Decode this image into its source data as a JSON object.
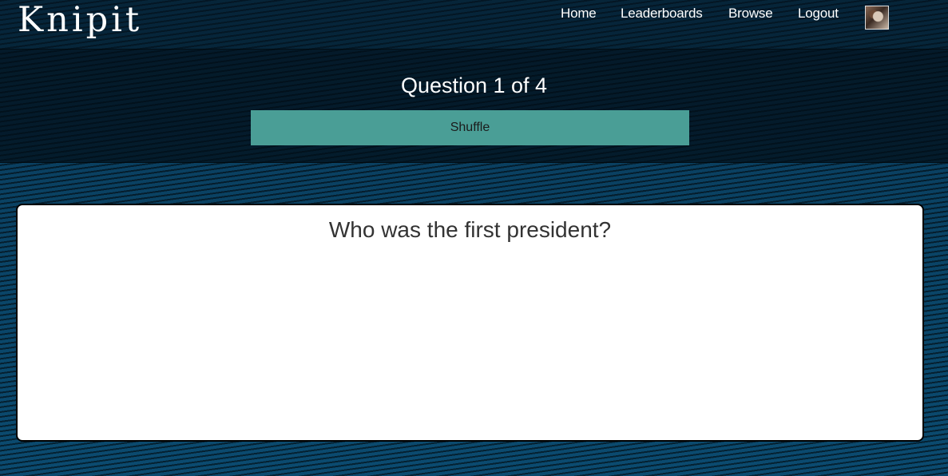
{
  "app": {
    "logo_text": "Knipit"
  },
  "nav": {
    "items": [
      {
        "label": "Home"
      },
      {
        "label": "Leaderboards"
      },
      {
        "label": "Browse"
      },
      {
        "label": "Logout"
      }
    ],
    "avatar_icon": "user-avatar-photo"
  },
  "quiz": {
    "counter": "Question 1 of 4",
    "shuffle_label": "Shuffle",
    "question": "Who was the first president?"
  },
  "colors": {
    "background": "#0a4568",
    "shuffle_button": "#4a9e96",
    "card": "#ffffff"
  }
}
